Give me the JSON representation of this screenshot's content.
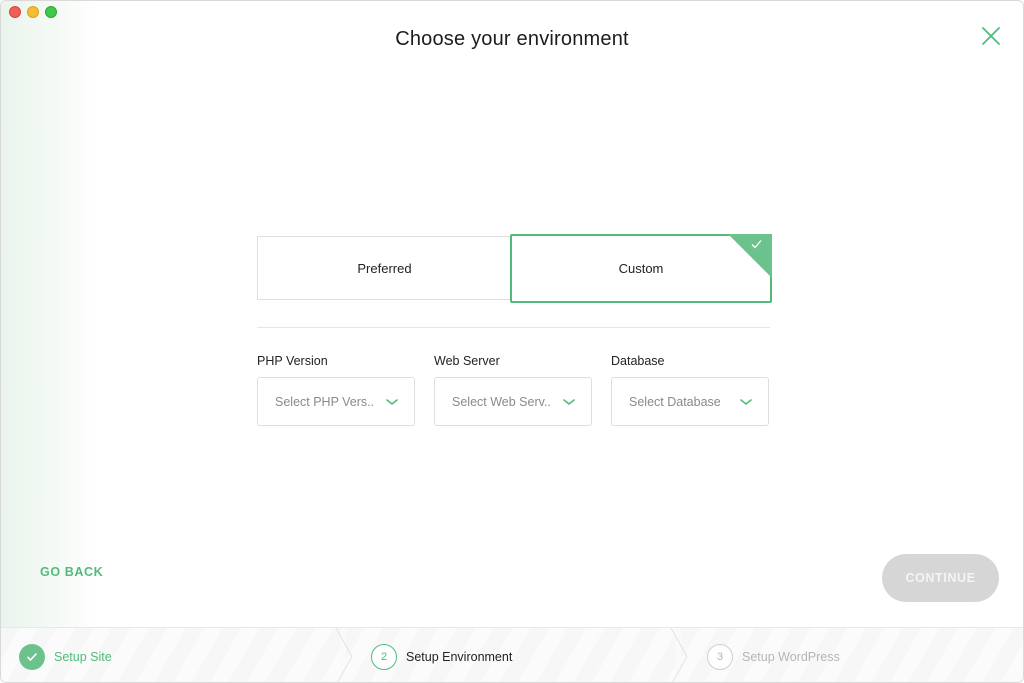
{
  "window": {
    "title": "Choose your environment"
  },
  "environment_choices": {
    "preferred_label": "Preferred",
    "custom_label": "Custom",
    "selected": "Custom"
  },
  "fields": {
    "php": {
      "label": "PHP Version",
      "placeholder": "Select PHP Vers..."
    },
    "web_server": {
      "label": "Web Server",
      "placeholder": "Select Web Serv..."
    },
    "database": {
      "label": "Database",
      "placeholder": "Select Database"
    }
  },
  "footer": {
    "go_back_label": "GO BACK",
    "continue_label": "CONTINUE"
  },
  "steps": [
    {
      "number": "1",
      "label": "Setup Site",
      "status": "done"
    },
    {
      "number": "2",
      "label": "Setup Environment",
      "status": "active"
    },
    {
      "number": "3",
      "label": "Setup WordPress",
      "status": "todo"
    }
  ],
  "colors": {
    "accent": "#51bb7b",
    "accent_light": "#6cc28c",
    "disabled_button": "#d6d6d6"
  }
}
